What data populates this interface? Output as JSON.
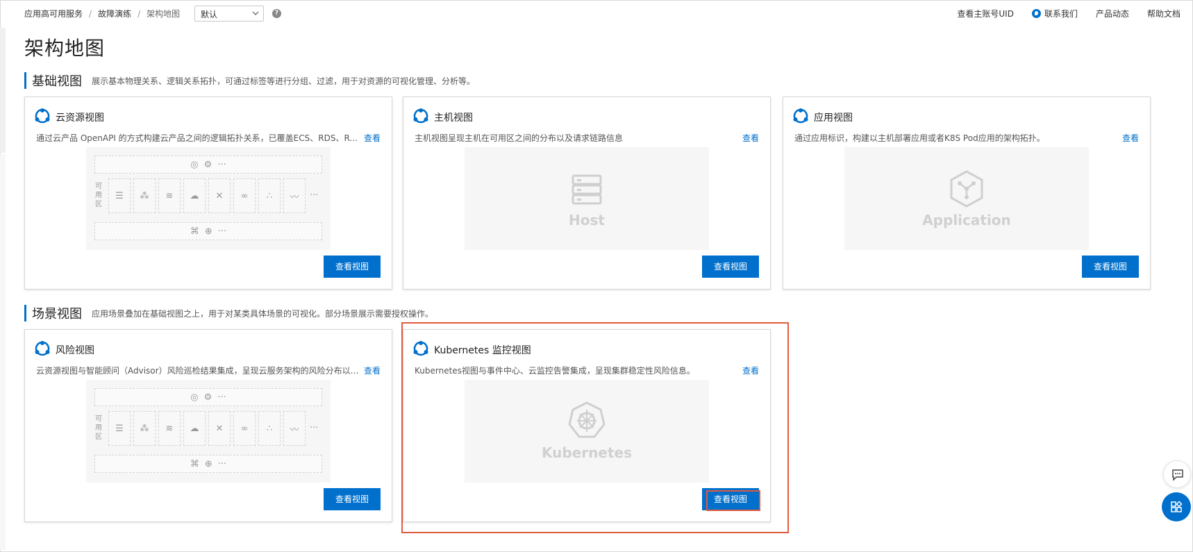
{
  "breadcrumb": [
    "应用高可用服务",
    "故障演练",
    "架构地图"
  ],
  "breadcrumb_sep": "/",
  "select": {
    "value": "默认"
  },
  "help_icon": "?",
  "top_links": [
    "查看主账号UID",
    "联系我们",
    "产品动态",
    "帮助文档"
  ],
  "page_title": "架构地图",
  "sections": [
    {
      "title": "基础视图",
      "desc": "展示基本物理关系、逻辑关系拓扑，可通过标签等进行分组、过滤，用于对资源的可视化管理、分析等。"
    },
    {
      "title": "场景视图",
      "desc": "应用场景叠加在基础视图之上，用于对某类具体场景的可视化。部分场景展示需要授权操作。"
    }
  ],
  "cards": [
    {
      "title": "云资源视图",
      "desc": "通过云产品 OpenAPI 的方式构建云产品之间的逻辑拓扑关系，已覆盖ECS、RDS、Redis、SLB等多种云产品。",
      "link": "查看",
      "button": "查看视图",
      "preview": "resources"
    },
    {
      "title": "主机视图",
      "desc": "主机视图呈现主机在可用区之间的分布以及请求链路信息",
      "link": "查看",
      "button": "查看视图",
      "preview": "Host"
    },
    {
      "title": "应用视图",
      "desc": "通过应用标识，构建以主机部署应用或者K8S Pod应用的架构拓扑。",
      "link": "查看",
      "button": "查看视图",
      "preview": "Application"
    },
    {
      "title": "风险视图",
      "desc": "云资源视图与智能顾问（Advisor）风险巡检结果集成，呈现云服务架构的风险分布以及风险详情。",
      "link": "查看",
      "button": "查看视图",
      "preview": "resources"
    },
    {
      "title": "Kubernetes 监控视图",
      "desc": "Kubernetes视图与事件中心、云监控告警集成，呈现集群稳定性风险信息。",
      "link": "查看",
      "button": "查看视图",
      "preview": "Kubernetes"
    }
  ],
  "zone_label": "可用区",
  "ellipsis": "···",
  "accent_color": "#0070cc",
  "highlight_color": "#e05a3e"
}
